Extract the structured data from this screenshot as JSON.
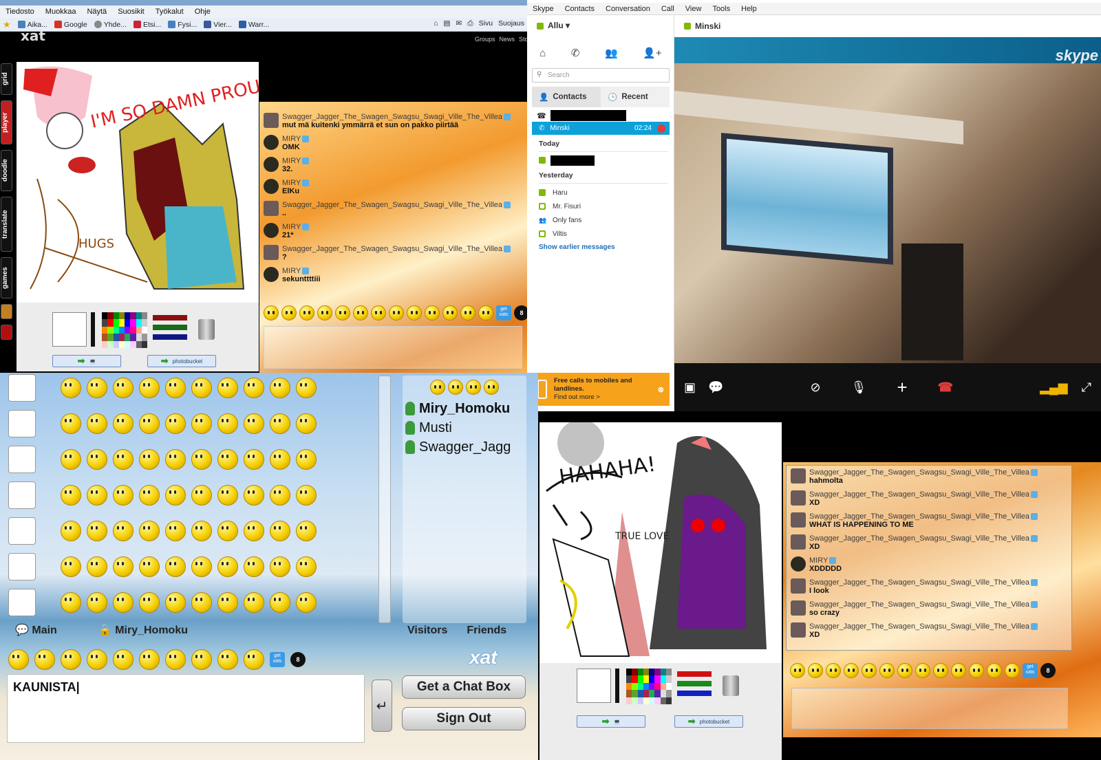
{
  "browser": {
    "menu": [
      "Tiedosto",
      "Muokkaa",
      "Näytä",
      "Suosikit",
      "Työkalut",
      "Ohje"
    ],
    "favorites": [
      "Aika...",
      "Google",
      "Yhde...",
      "Etsi...",
      "Fysi...",
      "Vier...",
      "Warr..."
    ],
    "commands": [
      "Sivu",
      "Suojaus"
    ]
  },
  "xat_top": {
    "logo": "xat",
    "links": [
      "Groups",
      "News",
      "Store"
    ],
    "side_tabs": [
      "grid",
      "player",
      "doodle",
      "translate",
      "games"
    ],
    "doodle_text": [
      "I'M SO DAMN PROUD",
      "HUGS"
    ],
    "upload_label": "photobucket",
    "messages": [
      {
        "name": "Swagger_Jagger_The_Swagen_Swagsu_Swagi_Ville_The_Villea",
        "text": "mut mä kuitenki ymmärrä et sun on pakko piirtää",
        "type": "swag"
      },
      {
        "name": "MIRY",
        "text": "OMK",
        "type": "miry"
      },
      {
        "name": "MIRY",
        "text": "32.",
        "type": "miry"
      },
      {
        "name": "MIRY",
        "text": "ElKu",
        "type": "miry"
      },
      {
        "name": "Swagger_Jagger_The_Swagen_Swagsu_Swagi_Ville_The_Villea",
        "text": "..",
        "type": "swag"
      },
      {
        "name": "MIRY",
        "text": "21*",
        "type": "miry"
      },
      {
        "name": "Swagger_Jagger_The_Swagen_Swagsu_Swagi_Ville_The_Villea",
        "text": "?",
        "type": "swag"
      },
      {
        "name": "MIRY",
        "text": "sekunttttiii",
        "type": "miry"
      }
    ],
    "getxats": "get xats"
  },
  "skype": {
    "menu": [
      "Skype",
      "Contacts",
      "Conversation",
      "Call",
      "View",
      "Tools",
      "Help"
    ],
    "user": "Allu",
    "search_placeholder": "Search",
    "tabs": {
      "contacts": "Contacts",
      "recent": "Recent"
    },
    "active_call": {
      "name": "Minski",
      "time": "02:24"
    },
    "today": "Today",
    "yesterday": "Yesterday",
    "recent": [
      {
        "name": "Haru",
        "online": true
      },
      {
        "name": "Mr. Fisuri",
        "online": false
      },
      {
        "name": "Only fans",
        "online": false,
        "group": true
      },
      {
        "name": "Viltis",
        "online": false
      }
    ],
    "show_earlier": "Show earlier messages",
    "ad": {
      "title": "Free calls to mobiles and landlines.",
      "link": "Find out more >"
    },
    "call_header": "Minski",
    "video_logo": "skype"
  },
  "xat_bottom_left": {
    "users": [
      "Miry_Homoku",
      "Musti",
      "Swagger_Jagg"
    ],
    "tabs": {
      "main": "Main",
      "pm": "Miry_Homoku"
    },
    "user_tabs": {
      "visitors": "Visitors",
      "friends": "Friends"
    },
    "input_value": "KAUNISTA",
    "get_chat_box": "Get a Chat Box",
    "sign_out": "Sign Out",
    "logo": "xat",
    "getxats": "get xats"
  },
  "xat_bottom_right": {
    "doodle_text": [
      "HAHAHA!",
      "TRUE LOVE"
    ],
    "upload_label": "photobucket",
    "messages": [
      {
        "name": "Swagger_Jagger_The_Swagen_Swagsu_Swagi_Ville_The_Villea",
        "text": "hahmolta",
        "type": "swag"
      },
      {
        "name": "Swagger_Jagger_The_Swagen_Swagsu_Swagi_Ville_The_Villea",
        "text": "XD",
        "type": "swag"
      },
      {
        "name": "Swagger_Jagger_The_Swagen_Swagsu_Swagi_Ville_The_Villea",
        "text": "WHAT IS HAPPENING TO ME",
        "type": "swag"
      },
      {
        "name": "Swagger_Jagger_The_Swagen_Swagsu_Swagi_Ville_The_Villea",
        "text": "XD",
        "type": "swag"
      },
      {
        "name": "MIRY",
        "text": "XDDDDD",
        "type": "miry"
      },
      {
        "name": "Swagger_Jagger_The_Swagen_Swagsu_Swagi_Ville_The_Villea",
        "text": "I look",
        "type": "swag"
      },
      {
        "name": "Swagger_Jagger_The_Swagen_Swagsu_Swagi_Ville_The_Villea",
        "text": "so crazy",
        "type": "swag"
      },
      {
        "name": "Swagger_Jagger_The_Swagen_Swagsu_Swagi_Ville_The_Villea",
        "text": "XD",
        "type": "swag"
      }
    ],
    "getxats": "get xats"
  }
}
